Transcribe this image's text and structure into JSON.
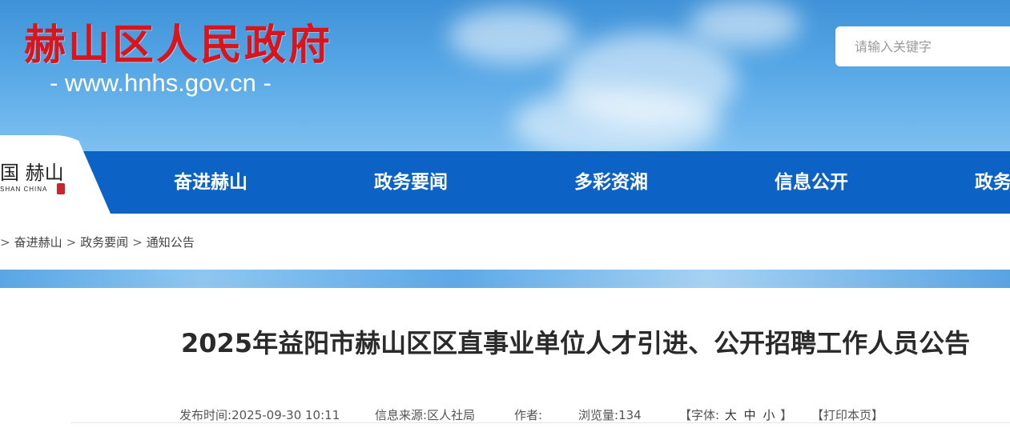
{
  "header": {
    "site_title": "赫山区人民政府",
    "site_url": "- www.hnhs.gov.cn -",
    "search_placeholder": "请输入关键字",
    "sky_color": "#56a7e6",
    "title_color": "#d9141b"
  },
  "logo": {
    "glyph_text": "国 赫山",
    "sub_text": "SHAN CHINA"
  },
  "nav": {
    "color": "#0c62c5",
    "items": [
      {
        "label": "奋进赫山"
      },
      {
        "label": "政务要闻"
      },
      {
        "label": "多彩资湘"
      },
      {
        "label": "信息公开"
      },
      {
        "label": "政务"
      }
    ]
  },
  "breadcrumb": {
    "separator": ">",
    "items": [
      "奋进赫山",
      "政务要闻",
      "通知公告"
    ]
  },
  "article": {
    "title": "2025年益阳市赫山区区直事业单位人才引进、公开招聘工作人员公告",
    "publish_label": "发布时间:",
    "publish_time": "2025-09-30 10:11",
    "source_label": "信息来源:",
    "source": "区人社局",
    "author_label": "作者:",
    "author": "",
    "views_label": "浏览量:",
    "views": "134",
    "font_label_open": "【字体:",
    "font_large": "大",
    "font_medium": "中",
    "font_small": "小",
    "font_label_close": "】",
    "print_label": "【打印本页】"
  }
}
